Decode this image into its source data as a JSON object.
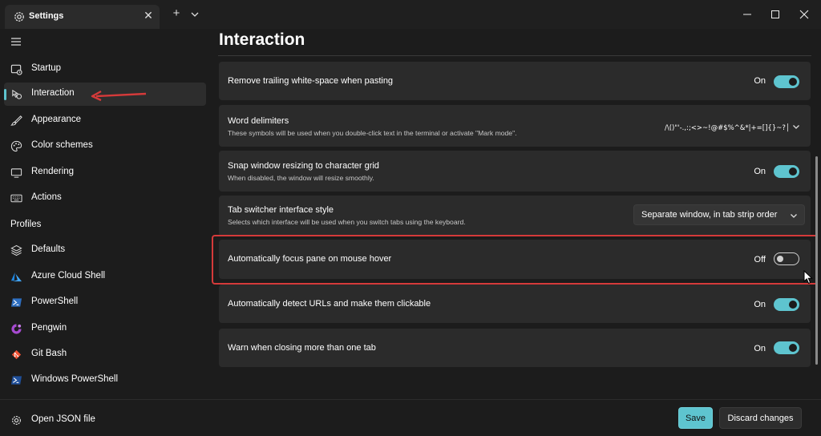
{
  "window": {
    "tab_title": "Settings",
    "tab_close_glyph": "✕",
    "new_tab_glyph": "+"
  },
  "sidebar": {
    "items": [
      {
        "label": "Startup",
        "icon": "startup-icon"
      },
      {
        "label": "Interaction",
        "icon": "interaction-icon",
        "selected": true
      },
      {
        "label": "Appearance",
        "icon": "appearance-icon"
      },
      {
        "label": "Color schemes",
        "icon": "color-schemes-icon"
      },
      {
        "label": "Rendering",
        "icon": "rendering-icon"
      },
      {
        "label": "Actions",
        "icon": "actions-icon"
      }
    ],
    "profiles_header": "Profiles",
    "profiles": [
      {
        "label": "Defaults",
        "icon": "layers-icon"
      },
      {
        "label": "Azure Cloud Shell",
        "icon": "azure-icon"
      },
      {
        "label": "PowerShell",
        "icon": "powershell-icon"
      },
      {
        "label": "Pengwin",
        "icon": "pengwin-icon"
      },
      {
        "label": "Git Bash",
        "icon": "git-icon"
      },
      {
        "label": "Windows PowerShell",
        "icon": "windows-powershell-icon"
      }
    ],
    "open_json": "Open JSON file"
  },
  "main": {
    "title": "Interaction",
    "settings": {
      "trailing_whitespace": {
        "title": "Remove trailing white-space when pasting",
        "state": "On"
      },
      "word_delimiters": {
        "title": "Word delimiters",
        "desc": "These symbols will be used when you double-click text in the terminal or activate \"Mark mode\".",
        "value": "/\\()\"'-.,:;<>~!@#$%^&*|+=[]{}~?│"
      },
      "snap_resize": {
        "title": "Snap window resizing to character grid",
        "desc": "When disabled, the window will resize smoothly.",
        "state": "On"
      },
      "tab_switcher": {
        "title": "Tab switcher interface style",
        "desc": "Selects which interface will be used when you switch tabs using the keyboard.",
        "value": "Separate window, in tab strip order"
      },
      "focus_pane": {
        "title": "Automatically focus pane on mouse hover",
        "state": "Off"
      },
      "detect_urls": {
        "title": "Automatically detect URLs and make them clickable",
        "state": "On"
      },
      "warn_close": {
        "title": "Warn when closing more than one tab",
        "state": "On"
      }
    }
  },
  "footer": {
    "save": "Save",
    "discard": "Discard changes"
  },
  "colors": {
    "accent": "#5ec4cf",
    "annotation": "#d53a3a",
    "background": "#1c1c1c",
    "card": "#2b2b2b"
  }
}
